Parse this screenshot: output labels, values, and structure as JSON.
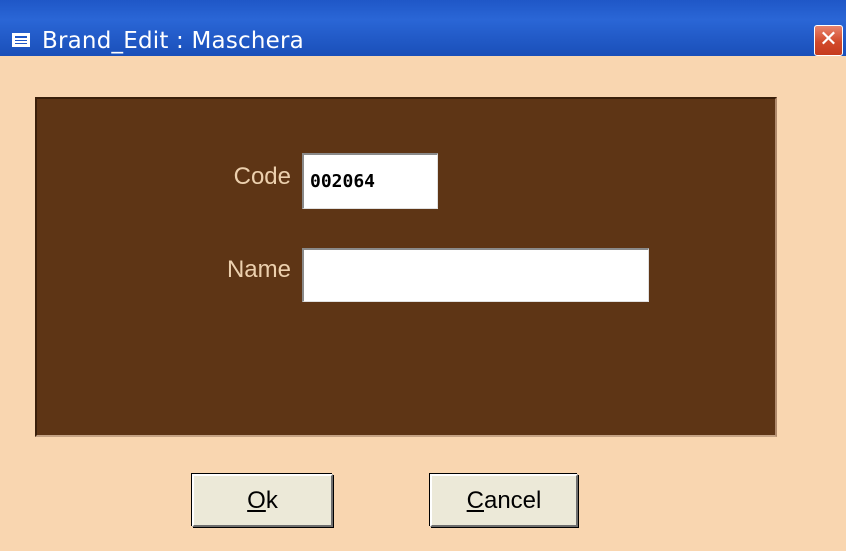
{
  "window": {
    "title": "Brand_Edit : Maschera",
    "close_label": "✕"
  },
  "form": {
    "code_label": "Code",
    "code_value": "002064",
    "name_label": "Name",
    "name_value": ""
  },
  "buttons": {
    "ok_label_accel": "O",
    "ok_label_rest": "k",
    "cancel_label_accel": "C",
    "cancel_label_rest": "ancel"
  },
  "colors": {
    "titlebar": "#2a66d6",
    "background": "#f9d6b0",
    "panel": "#5e3515",
    "label_text": "#ecd0ae",
    "button_face": "#ece9d8",
    "close_button": "#d24a2b"
  },
  "icons": {
    "title_icon": "form-icon",
    "close_icon": "close-icon"
  }
}
